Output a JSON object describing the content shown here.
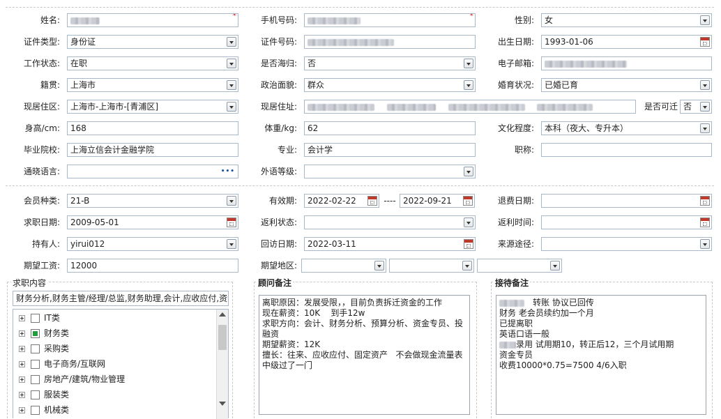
{
  "personal": {
    "name_label": "姓名:",
    "phone_label": "手机号码:",
    "gender_label": "性别:",
    "gender_value": "女",
    "idtype_label": "证件类型:",
    "idtype_value": "身份证",
    "idnum_label": "证件号码:",
    "birth_label": "出生日期:",
    "birth_value": "1993-01-06",
    "work_label": "工作状态:",
    "work_value": "在职",
    "overseas_label": "是否海归:",
    "overseas_value": "否",
    "email_label": "电子邮箱:",
    "native_label": "籍贯:",
    "native_value": "上海市",
    "political_label": "政治面貌:",
    "political_value": "群众",
    "marital_label": "婚育状况:",
    "marital_value": "已婚已育",
    "residence_label": "现居住区:",
    "residence_value": "上海市-上海市-[青浦区]",
    "address_label": "现居住址:",
    "relocate_label": "是否可迁",
    "relocate_value": "否",
    "height_label": "身高/cm:",
    "height_value": "168",
    "weight_label": "体重/kg:",
    "weight_value": "62",
    "edu_label": "文化程度:",
    "edu_value": "本科（夜大、专升本）",
    "school_label": "毕业院校:",
    "school_value": "上海立信会计金融学院",
    "major_label": "专业:",
    "major_value": "会计学",
    "title_label": "职称:",
    "lang_label": "通晓语言:",
    "lang_button": "•••",
    "foreign_label": "外语等级:"
  },
  "member": {
    "type_label": "会员种类:",
    "type_value": "21-B",
    "valid_label": "有效期:",
    "valid_from": "2022-02-22",
    "valid_sep": "----",
    "valid_to": "2022-09-21",
    "refund_date_label": "退费日期:",
    "job_date_label": "求职日期:",
    "job_date_value": "2009-05-01",
    "rebate_status_label": "返利状态:",
    "rebate_time_label": "返利时间:",
    "holder_label": "持有人:",
    "holder_value": "yirui012",
    "revisit_label": "回访日期:",
    "revisit_value": "2022-03-11",
    "source_label": "来源途径:",
    "salary_label": "期望工资:",
    "salary_value": "12000",
    "area_label": "期望地区:"
  },
  "job_section": {
    "title": "求职内容",
    "summary": "财务分析,财务主管/经理/总监,财务助理,会计,应收应付,资金专员",
    "tree": [
      {
        "label": "IT类",
        "checked": false
      },
      {
        "label": "财务类",
        "checked": true
      },
      {
        "label": "采购类",
        "checked": false
      },
      {
        "label": "电子商务/互联网",
        "checked": false
      },
      {
        "label": "房地产/建筑/物业管理",
        "checked": false
      },
      {
        "label": "服装类",
        "checked": false
      },
      {
        "label": "机械类",
        "checked": false
      }
    ]
  },
  "advisor_section": {
    "title": "顾问备注",
    "text": "离职原因：发展受限，，目前负责拆迁资金的工作\n现在薪资：10K    到手12w\n求职方向：会计、财务分析、预算分析、资金专员、投融资\n期望薪资：12K\n擅长：往来、应收应付、固定资产   不会做现金流量表\n中级过了一门"
  },
  "reception_section": {
    "title": "接待备注",
    "lines": [
      "转账 协议已回传",
      "财务      老会员续约加一个月",
      "已提离职",
      "英语口语一般",
      "录用 试用期10，转正后12，三个月试用期",
      "资金专员",
      "收费10000*0.75=7500    4/6入职"
    ]
  },
  "colors": {
    "border": "#a9b8c8",
    "required": "#d40000",
    "checked": "#1f9e3a"
  }
}
